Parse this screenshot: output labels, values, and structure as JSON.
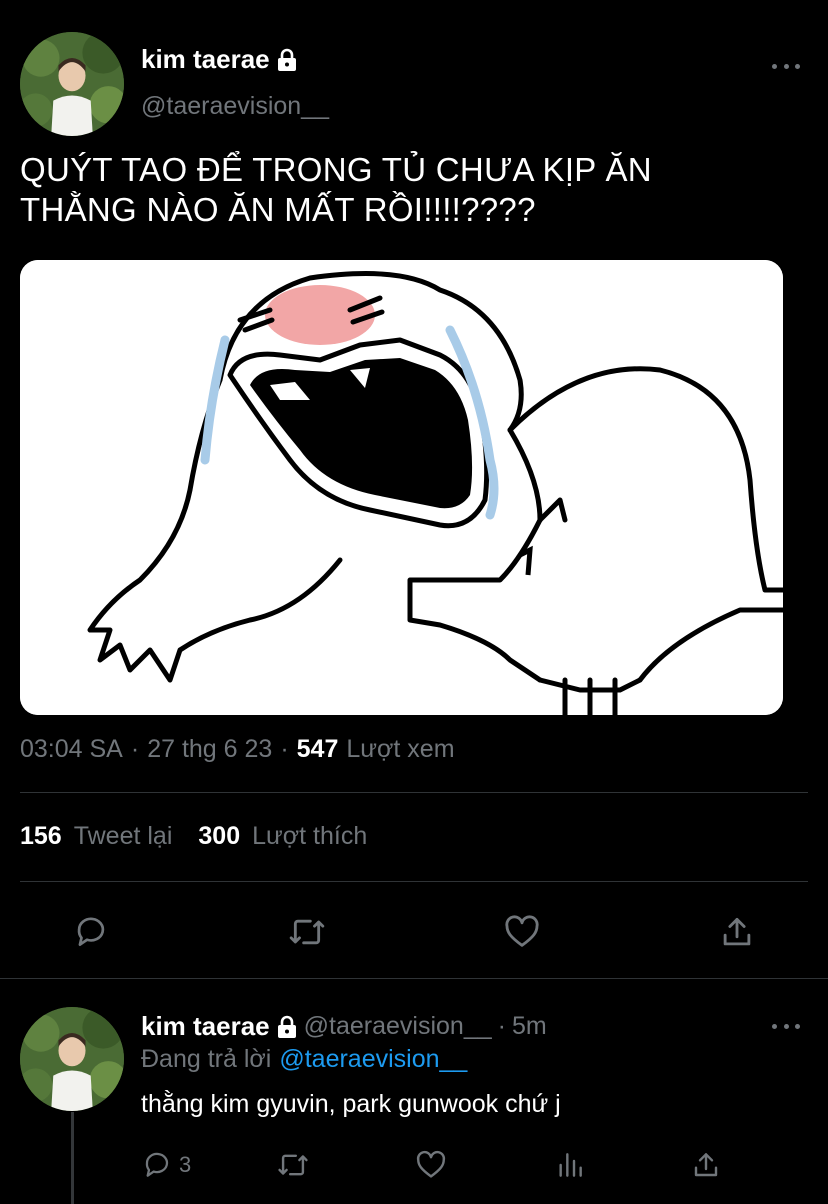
{
  "main_tweet": {
    "author_name": "kim taerae",
    "author_handle": "@taeraevision__",
    "text_line1": "QUÝT TAO ĐỂ TRONG TỦ CHƯA KỊP ĂN",
    "text_line2": "THẰNG NÀO ĂN MẤT RỒI!!!!????",
    "time": "03:04 SA",
    "date": "27 thg 6 23",
    "separator": "·",
    "views_count": "547",
    "views_label": "Lượt xem",
    "retweets_count": "156",
    "retweets_label": "Tweet lại",
    "likes_count": "300",
    "likes_label": "Lượt thích"
  },
  "reply": {
    "author_name": "kim taerae",
    "author_handle": "@taeraevision__",
    "separator": "·",
    "age": "5m",
    "replying_to_label": "Đang trả lời",
    "replying_to_handle": "@taeraevision__",
    "text": "thằng kim gyuvin, park gunwook chứ j",
    "reply_count": "3"
  },
  "icons": {
    "reply": "reply-icon",
    "retweet": "retweet-icon",
    "like": "heart-icon",
    "share": "share-icon",
    "views": "analytics-icon",
    "more": "more-icon",
    "lock": "lock-icon"
  },
  "colors": {
    "background": "#000000",
    "text": "#ffffff",
    "secondary": "#71767b",
    "accent": "#1d9bf0",
    "divider": "#2f3336"
  }
}
